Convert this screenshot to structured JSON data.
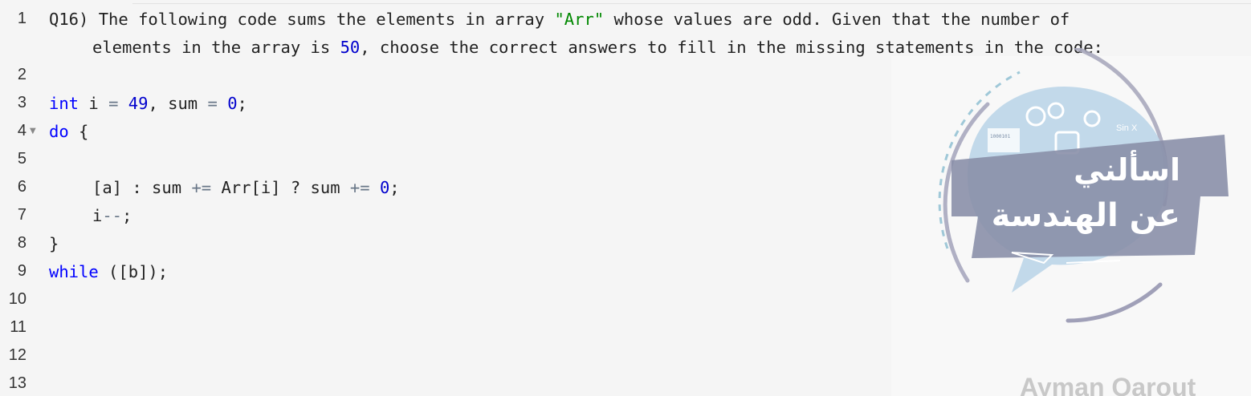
{
  "line_numbers": [
    "1",
    "2",
    "3",
    "4",
    "5",
    "6",
    "7",
    "8",
    "9",
    "10",
    "11",
    "12",
    "13"
  ],
  "question": {
    "label": "Q16)",
    "text_part1": "The following code sums the elements in array ",
    "array_name": "\"Arr\"",
    "text_part2": " whose values are odd. Given that the number of",
    "text_part3": "elements in the array is ",
    "count": "50",
    "text_part4": ", choose the correct answers to fill in the missing statements in the code:"
  },
  "code": {
    "line3": {
      "kw": "int",
      "var_i": " i ",
      "eq1": "=",
      "val_i": "49",
      "mid": ", sum ",
      "eq2": "=",
      "val_sum": "0",
      "end": ";"
    },
    "line4": {
      "kw": "do",
      "rest": " {"
    },
    "line6": {
      "blank_a": "[a]",
      "colon": " : sum ",
      "op1": "+=",
      "expr": " Arr[i] ? sum ",
      "op2": "+=",
      "zero": "0",
      "end": ";"
    },
    "line7": {
      "var": "i",
      "op": "--",
      "end": ";"
    },
    "line8": {
      "text": "}"
    },
    "line9": {
      "kw": "while",
      "rest": " ([b]);"
    }
  },
  "watermark": {
    "arabic_line1": "اسألني",
    "arabic_line2": "عن الهندسة",
    "author": "Ayman Qarout",
    "math_note": "Sin X",
    "binary": "1000101",
    "colors": {
      "bubble": "#b8d4e8",
      "banner": "#8a8fa8",
      "ring": "#9a9ab0"
    }
  }
}
